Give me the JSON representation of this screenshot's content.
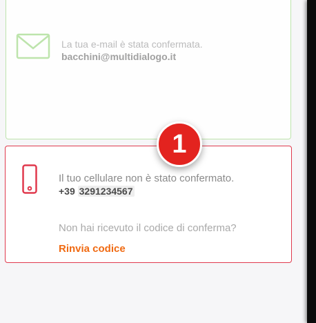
{
  "email_card": {
    "message": "La tua e-mail è stata confermata.",
    "address": "bacchini@multidialogo.it",
    "icon": "envelope-icon",
    "accent_color": "#b9e3a6"
  },
  "phone_card": {
    "message": "Il tuo cellulare non è stato confermato.",
    "prefix": "+39",
    "number": "3291234567",
    "resend_question": "Non hai ricevuto il codice di conferma?",
    "resend_label": "Rinvia codice",
    "icon": "smartphone-icon",
    "accent_color": "#e0394d",
    "link_color": "#f06a12"
  },
  "step_badge": {
    "label": "1",
    "color": "#e3231f"
  }
}
